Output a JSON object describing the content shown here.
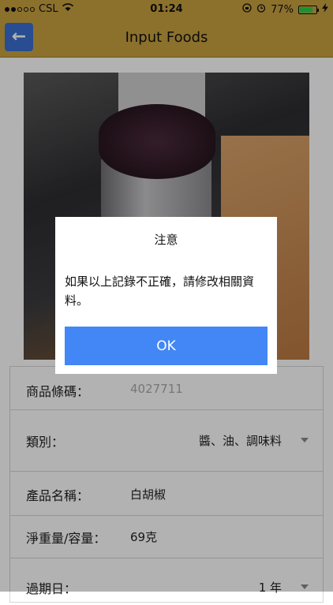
{
  "status_bar": {
    "carrier": "CSL",
    "time": "01:24",
    "battery": "77%"
  },
  "nav": {
    "back_icon": "arrow-left-icon",
    "title": "Input Foods"
  },
  "form": {
    "barcode_label": "商品條碼：",
    "barcode_value": "4027711",
    "category_label": "類別：",
    "category_value": "醬、油、調味料",
    "name_label": "產品名稱：",
    "name_value": "白胡椒",
    "weight_label": "淨重量/容量：",
    "weight_value": "69克",
    "expiry_label": "過期日：",
    "expiry_value": "1 年"
  },
  "dialog": {
    "title": "注意",
    "message": "如果以上記錄不正確，請修改相關資料。",
    "ok_label": "OK"
  },
  "colors": {
    "nav": "#c9a341",
    "back_button": "#3a6fd1",
    "ok_button": "#4287f5"
  }
}
